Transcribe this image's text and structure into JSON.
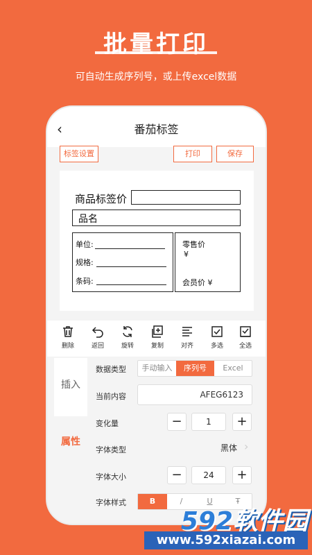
{
  "hero": {
    "title": "批量打印",
    "subtitle": "可自动生成序列号，或上传excel数据"
  },
  "app": {
    "title": "番茄标签",
    "buttons": {
      "label_settings": "标签设置",
      "print": "打印",
      "save": "保存"
    }
  },
  "label": {
    "price_title": "商品标签价",
    "name": "品名",
    "unit": "单位:",
    "spec": "规格:",
    "barcode": "条码:",
    "retail_price": "零售价",
    "yen": "¥",
    "member_price": "会员价 ¥"
  },
  "toolbar": [
    {
      "label": "删除",
      "icon": "trash-icon"
    },
    {
      "label": "返回",
      "icon": "undo-icon"
    },
    {
      "label": "旋转",
      "icon": "rotate-icon"
    },
    {
      "label": "复制",
      "icon": "copy-icon"
    },
    {
      "label": "对齐",
      "icon": "align-icon"
    },
    {
      "label": "多选",
      "icon": "checkbox-icon"
    },
    {
      "label": "全选",
      "icon": "select-all-icon"
    }
  ],
  "panel": {
    "tabs": {
      "insert": "插入",
      "attributes": "属性"
    },
    "data_type": {
      "label": "数据类型",
      "options": [
        "手动输入",
        "序列号",
        "Excel"
      ],
      "selected": "序列号"
    },
    "current_content": {
      "label": "当前内容",
      "value": "AFEG6123"
    },
    "increment": {
      "label": "变化量",
      "value": "1",
      "minus": "−",
      "plus": "+"
    },
    "font_type": {
      "label": "字体类型",
      "value": "黑体"
    },
    "font_size": {
      "label": "字体大小",
      "value": "24",
      "minus": "−",
      "plus": "+"
    },
    "font_style": {
      "label": "字体样式",
      "options": [
        "B",
        "/",
        "U",
        "Ŧ"
      ],
      "selected": "B"
    }
  },
  "watermark": {
    "brand_num": "592",
    "brand_text": "软件园",
    "url": "www.592xiazai.com"
  },
  "colors": {
    "accent": "#f26a3f",
    "watermark_blue": "#2a63b8"
  }
}
